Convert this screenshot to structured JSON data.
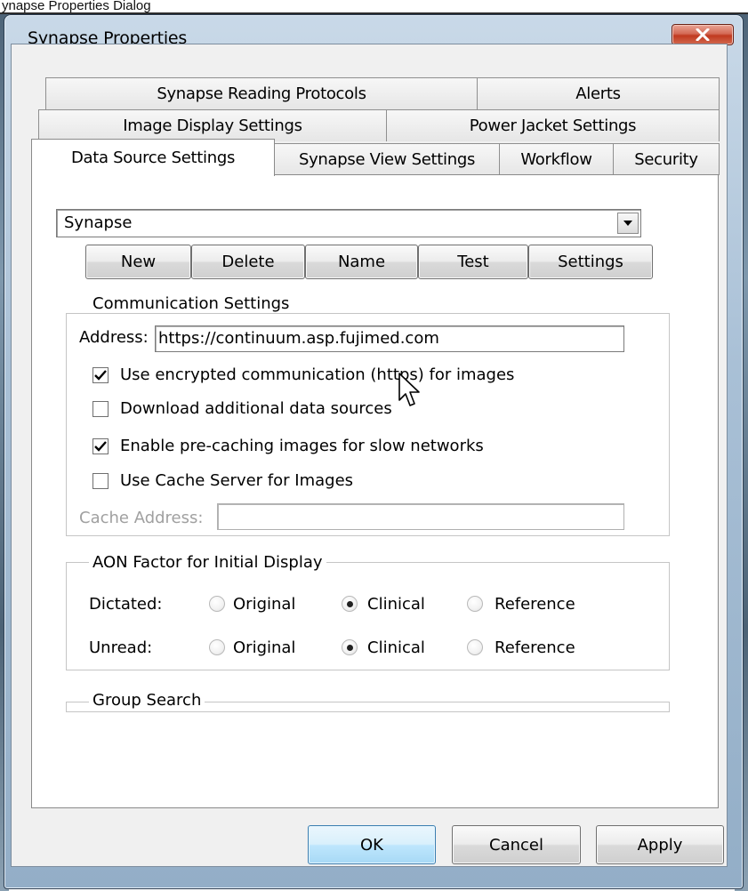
{
  "background": {
    "caption": "ynapse Properties Dialog"
  },
  "window": {
    "title": "Synapse Properties"
  },
  "tabs": {
    "row1": [
      "Synapse Reading Protocols",
      "Alerts"
    ],
    "row2": [
      "Image Display Settings",
      "Power Jacket Settings"
    ],
    "row3": [
      "Data Source Settings",
      "Synapse View Settings",
      "Workflow",
      "Security"
    ],
    "active": "Data Source Settings"
  },
  "data_source": {
    "selected": "Synapse"
  },
  "source_buttons": [
    "New",
    "Delete",
    "Name",
    "Test",
    "Settings"
  ],
  "communication": {
    "legend": "Communication Settings",
    "address_label": "Address:",
    "address_value": "https://continuum.asp.fujimed.com",
    "options": [
      {
        "label": "Use encrypted communication (https) for images",
        "checked": true
      },
      {
        "label": "Download additional data sources",
        "checked": false
      },
      {
        "label": "Enable pre-caching images for slow networks",
        "checked": true
      },
      {
        "label": "Use Cache Server for Images",
        "checked": false
      }
    ],
    "cache_label": "Cache Address:",
    "cache_value": ""
  },
  "aon": {
    "legend": "AON Factor for Initial Display",
    "options": [
      "Original",
      "Clinical",
      "Reference"
    ],
    "rows": [
      {
        "label": "Dictated:",
        "selected": "Clinical"
      },
      {
        "label": "Unread:",
        "selected": "Clinical"
      }
    ]
  },
  "group_search": {
    "legend": "Group Search"
  },
  "footer": {
    "ok": "OK",
    "cancel": "Cancel",
    "apply": "Apply"
  }
}
